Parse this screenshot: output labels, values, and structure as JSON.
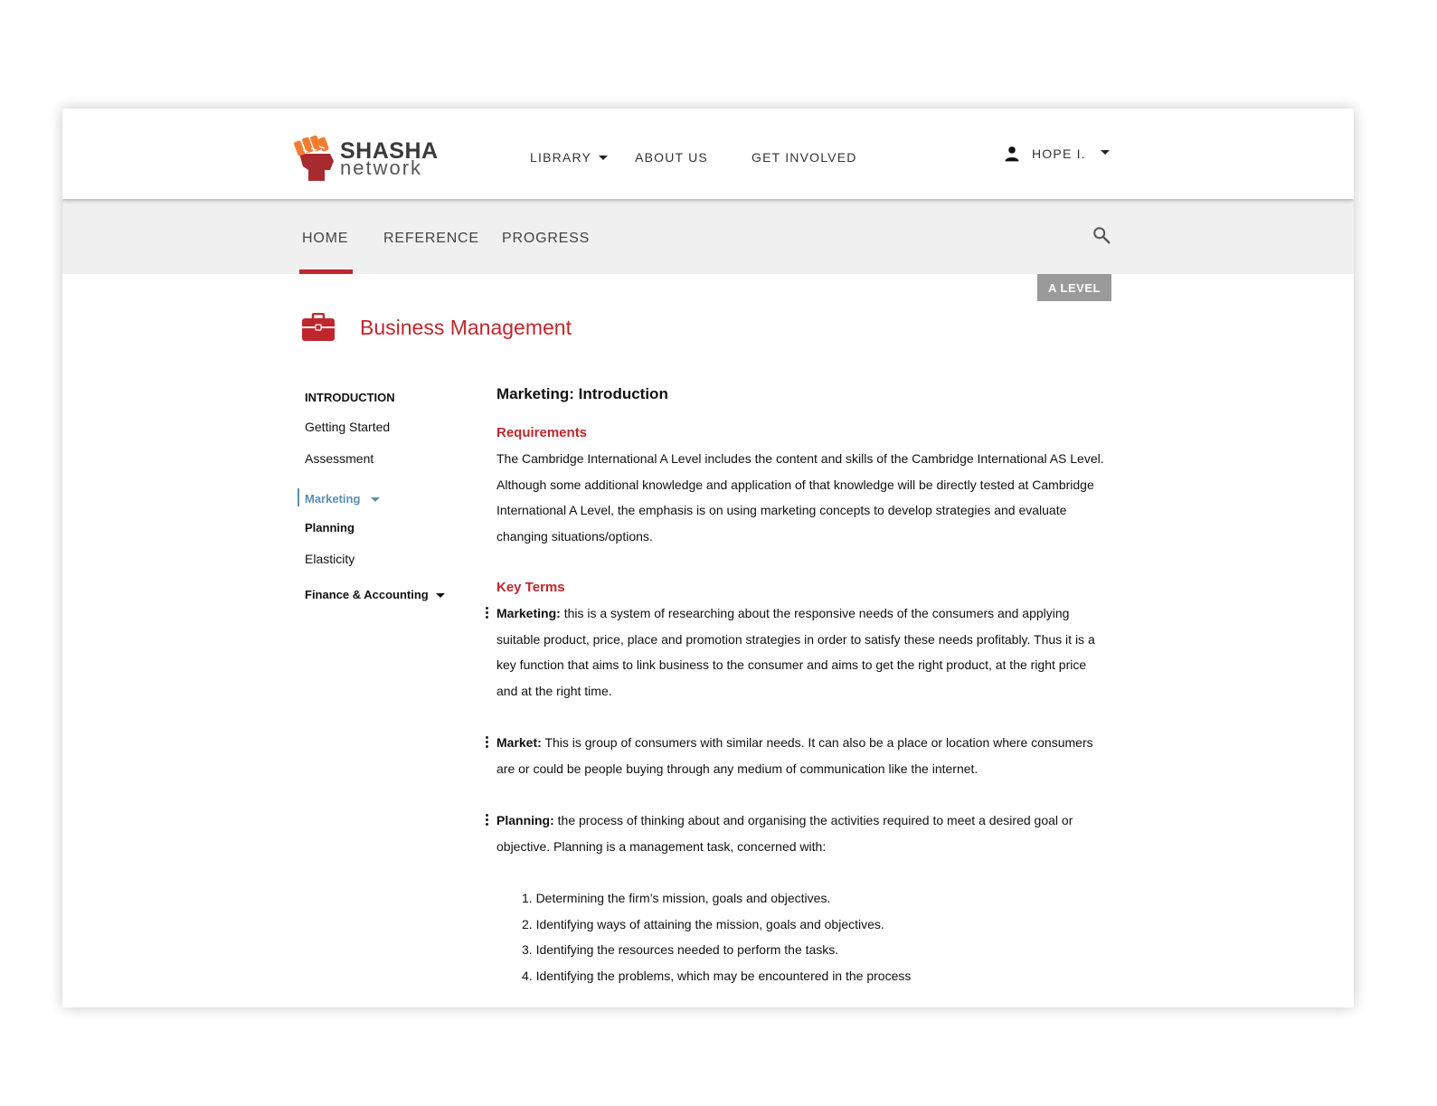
{
  "brand": {
    "name": "SHASHA",
    "sub": "network",
    "colors": {
      "fist": "#a72a2f",
      "accent": "#f47c30"
    }
  },
  "topnav": {
    "library": "LIBRARY",
    "about": "ABOUT US",
    "involved": "GET INVOLVED",
    "user": "HOPE I."
  },
  "subnav": {
    "home": "HOME",
    "reference": "REFERENCE",
    "progress": "PROGRESS"
  },
  "level_badge": "A  LEVEL",
  "course": {
    "icon": "briefcase-icon",
    "title": "Business Management"
  },
  "sidebar": {
    "section": "INTRODUCTION",
    "items": [
      "Getting Started",
      "Assessment"
    ],
    "active": "Marketing",
    "sub_items": [
      "Planning",
      "Elasticity"
    ],
    "finance": "Finance & Accounting"
  },
  "content": {
    "heading": "Marketing: Introduction",
    "requirements_title": "Requirements",
    "requirements_text": "The Cambridge International A Level includes the content and skills of the Cambridge International AS Level. Although some additional knowledge and application of that knowledge will be directly tested at Cambridge International A Level, the emphasis is on using marketing concepts to develop strategies and evaluate changing situations/options.",
    "key_terms_title": "Key Terms",
    "terms": [
      {
        "term": "Marketing:",
        "definition": "this is a system of researching about the responsive needs of the consumers and applying suitable product, price, place and promotion strategies in order to satisfy these needs profitably. Thus it is a key function that aims to link business to the consumer and aims to get the right product, at the right price and at the right time."
      },
      {
        "term": "Market:",
        "definition": "This is group of consumers with similar needs. It can also be a place or location where consumers are or could be people buying through any medium of communication like the internet."
      },
      {
        "term": "Planning:",
        "definition": "the process of thinking about and organising the activities required to meet a desired goal or objective. Planning is a management task, concerned with:"
      }
    ],
    "planning_list": [
      "1. Determining the firm’s mission, goals and objectives.",
      "2. Identifying ways of attaining the mission, goals and objectives.",
      "3. Identifying the resources needed to perform the tasks.",
      "4. Identifying the problems, which may be encountered in the process"
    ]
  }
}
